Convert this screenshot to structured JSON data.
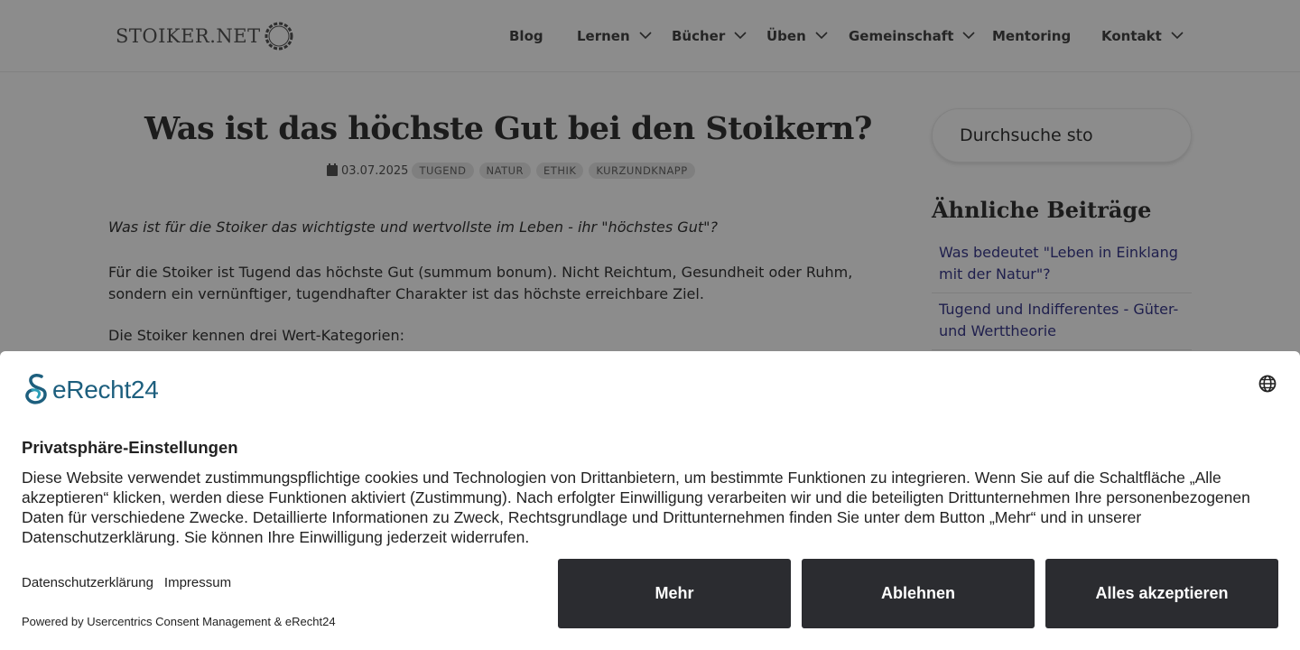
{
  "header": {
    "logo_text": "STOIKER.NET",
    "nav": [
      {
        "label": "Blog",
        "has_dropdown": false
      },
      {
        "label": "Lernen",
        "has_dropdown": true
      },
      {
        "label": "Bücher",
        "has_dropdown": true
      },
      {
        "label": "Üben",
        "has_dropdown": true
      },
      {
        "label": "Gemeinschaft",
        "has_dropdown": true
      },
      {
        "label": "Mentoring",
        "has_dropdown": false
      },
      {
        "label": "Kontakt",
        "has_dropdown": true
      }
    ]
  },
  "article": {
    "title": "Was ist das höchste Gut bei den Stoikern?",
    "date": "03.07.2025",
    "tags": [
      "TUGEND",
      "NATUR",
      "ETHIK",
      "KURZUNDKNAPP"
    ],
    "intro": "Was ist für die Stoiker das wichtigste und wertvollste im Leben - ihr \"höchstes Gut\"?",
    "paragraph1": "Für die Stoiker ist Tugend das höchste Gut (summum bonum). Nicht Reichtum, Gesundheit oder Ruhm, sondern ein vernünftiger, tugendhafter Charakter ist das höchste erreichbare Ziel.",
    "paragraph2": "Die Stoiker kennen drei Wert-Kategorien:"
  },
  "sidebar": {
    "search_value": "Durchsuche sto",
    "related_heading": "Ähnliche Beiträge",
    "related": [
      "Was bedeutet \"Leben in Einklang mit der Natur\"?",
      "Tugend und Indifferentes - Güter- und Werttheorie"
    ]
  },
  "consent": {
    "brand": "eRecht24",
    "title": "Privatsphäre-Einstellungen",
    "text": "Diese Website verwendet zustimmungspflichtige cookies und Technologien von Drittanbietern, um bestimmte Funktionen zu integrieren. Wenn Sie auf die Schaltfläche „Alle akzeptieren“ klicken, werden diese Funktionen aktiviert (Zustimmung). Nach erfolgter Einwilligung verarbeiten wir und die beteiligten Drittunternehmen Ihre personenbezogenen Daten für verschiedene Zwecke. Detaillierte Informationen zu Zweck, Rechtsgrundlage und Drittunternehmen finden Sie unter dem Button „Mehr“ und in unserer Datenschutzerklärung. Sie können Ihre Einwilligung jederzeit widerrufen.",
    "links": [
      "Datenschutzerklärung",
      "Impressum"
    ],
    "powered_by": "Powered by Usercentrics Consent Management & eRecht24",
    "buttons": {
      "more": "Mehr",
      "decline": "Ablehnen",
      "accept_all": "Alles akzeptieren"
    },
    "button_color": "#2b2c30",
    "brand_color": "#1d5f7e"
  }
}
